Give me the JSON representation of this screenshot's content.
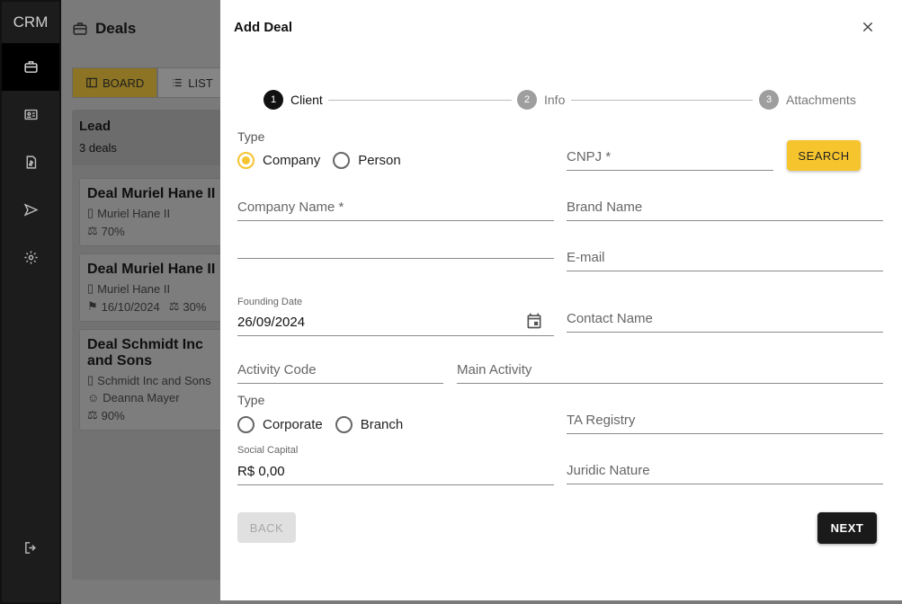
{
  "nav": {
    "logo": "CRM",
    "items": [
      {
        "icon": "briefcase-icon",
        "active": true
      },
      {
        "icon": "contact-card-icon"
      },
      {
        "icon": "invoice-icon"
      },
      {
        "icon": "send-icon"
      },
      {
        "icon": "gear-icon"
      }
    ],
    "logout_icon": "logout-icon"
  },
  "app": {
    "title": "Deals",
    "view_toggle": {
      "board": "BOARD",
      "list": "LIST"
    },
    "column": {
      "title": "Lead",
      "count": "3 deals",
      "cards": [
        {
          "title": "Deal Muriel Hane II",
          "company": "Muriel Hane II",
          "probability": "70%"
        },
        {
          "title": "Deal Muriel Hane II",
          "company": "Muriel Hane II",
          "date": "16/10/2024",
          "probability": "30%"
        },
        {
          "title": "Deal Schmidt Inc and Sons",
          "company": "Schmidt Inc and Sons",
          "contact": "Deanna Mayer",
          "probability": "90%"
        }
      ]
    }
  },
  "dialog": {
    "title": "Add Deal",
    "steps": [
      {
        "num": "1",
        "label": "Client"
      },
      {
        "num": "2",
        "label": "Info"
      },
      {
        "num": "3",
        "label": "Attachments"
      }
    ],
    "type_label": "Type",
    "type_options": {
      "company": "Company",
      "person": "Person"
    },
    "cnpj_placeholder": "CNPJ *",
    "search_label": "SEARCH",
    "company_name_placeholder": "Company Name *",
    "brand_name_placeholder": "Brand Name",
    "email_placeholder": "E-mail",
    "founding_date_label": "Founding Date",
    "founding_date_value": "26/09/2024",
    "contact_name_placeholder": "Contact Name",
    "activity_code_placeholder": "Activity Code",
    "main_activity_placeholder": "Main Activity",
    "type2_label": "Type",
    "type2_options": {
      "corporate": "Corporate",
      "branch": "Branch"
    },
    "ta_registry_placeholder": "TA Registry",
    "social_capital_label": "Social Capital",
    "social_capital_value": "R$ 0,00",
    "juridic_nature_placeholder": "Juridic Nature",
    "back_label": "BACK",
    "next_label": "NEXT"
  },
  "colors": {
    "accent": "#f5c431",
    "primary_dark": "#1a1a1a"
  }
}
